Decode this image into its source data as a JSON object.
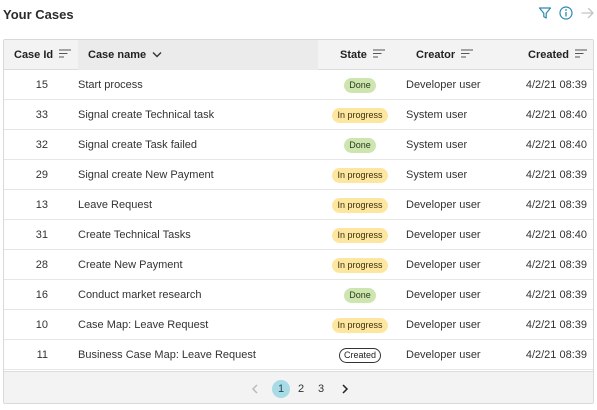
{
  "header": {
    "title": "Your Cases"
  },
  "columns": {
    "case_id": "Case Id",
    "case_name": "Case name",
    "state": "State",
    "creator": "Creator",
    "created": "Created"
  },
  "rows": [
    {
      "id": "15",
      "name": "Start process",
      "state": "Done",
      "state_type": "done",
      "creator": "Developer user",
      "created": "4/2/21 08:39"
    },
    {
      "id": "33",
      "name": "Signal create Technical task",
      "state": "In progress",
      "state_type": "progress",
      "creator": "System user",
      "created": "4/2/21 08:40"
    },
    {
      "id": "32",
      "name": "Signal create Task failed",
      "state": "Done",
      "state_type": "done",
      "creator": "System user",
      "created": "4/2/21 08:40"
    },
    {
      "id": "29",
      "name": "Signal create New Payment",
      "state": "In progress",
      "state_type": "progress",
      "creator": "System user",
      "created": "4/2/21 08:39"
    },
    {
      "id": "13",
      "name": "Leave Request",
      "state": "In progress",
      "state_type": "progress",
      "creator": "Developer user",
      "created": "4/2/21 08:39"
    },
    {
      "id": "31",
      "name": "Create Technical Tasks",
      "state": "In progress",
      "state_type": "progress",
      "creator": "Developer user",
      "created": "4/2/21 08:40"
    },
    {
      "id": "28",
      "name": "Create New Payment",
      "state": "In progress",
      "state_type": "progress",
      "creator": "Developer user",
      "created": "4/2/21 08:39"
    },
    {
      "id": "16",
      "name": "Conduct market research",
      "state": "Done",
      "state_type": "done",
      "creator": "Developer user",
      "created": "4/2/21 08:39"
    },
    {
      "id": "10",
      "name": "Case Map: Leave Request",
      "state": "In progress",
      "state_type": "progress",
      "creator": "Developer user",
      "created": "4/2/21 08:39"
    },
    {
      "id": "11",
      "name": "Business Case Map: Leave Request",
      "state": "Created",
      "state_type": "created",
      "creator": "Developer user",
      "created": "4/2/21 08:39"
    }
  ],
  "pagination": {
    "pages": [
      "1",
      "2",
      "3"
    ],
    "current": "1"
  },
  "icons": {
    "filter": "filter-icon",
    "info": "info-icon",
    "navigate": "arrow-right-icon",
    "sort": "sort-lines-icon",
    "dropdown": "chevron-down-icon"
  },
  "colors": {
    "accent": "#2a8ab0",
    "done_badge": "#cde6b0",
    "progress_badge": "#fde7a0",
    "current_page": "#a9dbe6"
  }
}
